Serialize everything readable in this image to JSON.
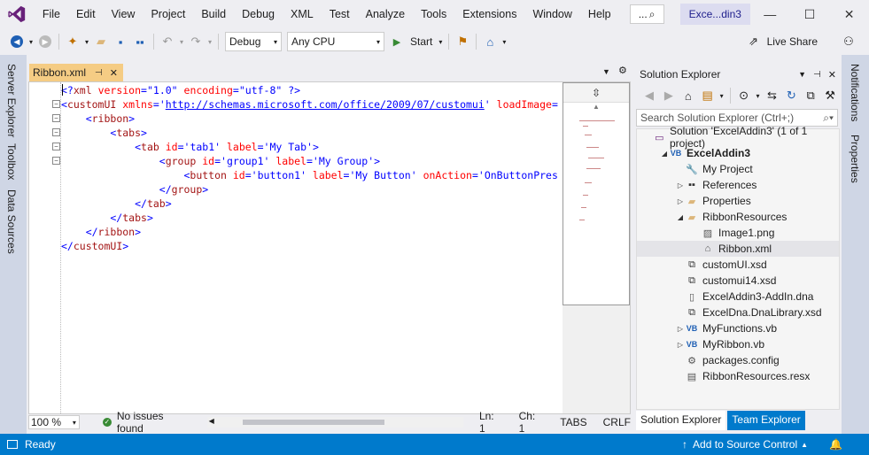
{
  "menu": [
    "File",
    "Edit",
    "View",
    "Project",
    "Build",
    "Debug",
    "XML",
    "Test",
    "Analyze",
    "Tools",
    "Extensions",
    "Window",
    "Help"
  ],
  "search_box": "...",
  "window_title": "Exce...din3",
  "toolbar": {
    "config": "Debug",
    "platform": "Any CPU",
    "start_label": "Start",
    "live_share_label": "Live Share"
  },
  "left_dock": [
    "Server Explorer",
    "Toolbox",
    "Data Sources"
  ],
  "right_dock": [
    "Notifications",
    "Properties"
  ],
  "editor": {
    "tab_label": "Ribbon.xml",
    "lines": [
      [
        [
          "x-punct",
          "<?"
        ],
        [
          "x-tag",
          "xml"
        ],
        [
          "x-attr",
          " version"
        ],
        [
          "x-punct",
          "="
        ],
        [
          "x-val",
          "\"1.0\""
        ],
        [
          "x-attr",
          " encoding"
        ],
        [
          "x-punct",
          "="
        ],
        [
          "x-val",
          "\"utf-8\""
        ],
        [
          "x-punct",
          " ?>"
        ]
      ],
      [
        [
          "x-punct",
          "<"
        ],
        [
          "x-tag",
          "customUI"
        ],
        [
          "x-attr",
          " xmlns"
        ],
        [
          "x-punct",
          "="
        ],
        [
          "x-punct",
          "'"
        ],
        [
          "x-url",
          "http://schemas.microsoft.com/office/2009/07/customui"
        ],
        [
          "x-punct",
          "'"
        ],
        [
          "x-attr",
          " loadImage"
        ],
        [
          "x-punct",
          "="
        ]
      ],
      [
        [
          "x-punct",
          "    <"
        ],
        [
          "x-tag",
          "ribbon"
        ],
        [
          "x-punct",
          ">"
        ]
      ],
      [
        [
          "x-punct",
          "        <"
        ],
        [
          "x-tag",
          "tabs"
        ],
        [
          "x-punct",
          ">"
        ]
      ],
      [
        [
          "x-punct",
          "            <"
        ],
        [
          "x-tag",
          "tab"
        ],
        [
          "x-attr",
          " id"
        ],
        [
          "x-punct",
          "="
        ],
        [
          "x-val",
          "'tab1'"
        ],
        [
          "x-attr",
          " label"
        ],
        [
          "x-punct",
          "="
        ],
        [
          "x-val",
          "'My Tab'"
        ],
        [
          "x-punct",
          ">"
        ]
      ],
      [
        [
          "x-punct",
          "                <"
        ],
        [
          "x-tag",
          "group"
        ],
        [
          "x-attr",
          " id"
        ],
        [
          "x-punct",
          "="
        ],
        [
          "x-val",
          "'group1'"
        ],
        [
          "x-attr",
          " label"
        ],
        [
          "x-punct",
          "="
        ],
        [
          "x-val",
          "'My Group'"
        ],
        [
          "x-punct",
          ">"
        ]
      ],
      [
        [
          "x-punct",
          "                    <"
        ],
        [
          "x-tag",
          "button"
        ],
        [
          "x-attr",
          " id"
        ],
        [
          "x-punct",
          "="
        ],
        [
          "x-val",
          "'button1'"
        ],
        [
          "x-attr",
          " label"
        ],
        [
          "x-punct",
          "="
        ],
        [
          "x-val",
          "'My Button'"
        ],
        [
          "x-attr",
          " onAction"
        ],
        [
          "x-punct",
          "="
        ],
        [
          "x-val",
          "'OnButtonPres"
        ]
      ],
      [
        [
          "x-punct",
          "                </"
        ],
        [
          "x-tag",
          "group"
        ],
        [
          "x-punct",
          ">"
        ]
      ],
      [
        [
          "x-punct",
          "            </"
        ],
        [
          "x-tag",
          "tab"
        ],
        [
          "x-punct",
          ">"
        ]
      ],
      [
        [
          "x-punct",
          "        </"
        ],
        [
          "x-tag",
          "tabs"
        ],
        [
          "x-punct",
          ">"
        ]
      ],
      [
        [
          "x-punct",
          "    </"
        ],
        [
          "x-tag",
          "ribbon"
        ],
        [
          "x-punct",
          ">"
        ]
      ],
      [
        [
          "x-punct",
          "</"
        ],
        [
          "x-tag",
          "customUI"
        ],
        [
          "x-punct",
          ">"
        ]
      ]
    ],
    "zoom": "100 %",
    "issues": "No issues found",
    "ln": "Ln: 1",
    "ch": "Ch: 1",
    "tabs": "TABS",
    "crlf": "CRLF"
  },
  "solution_explorer": {
    "title": "Solution Explorer",
    "search_placeholder": "Search Solution Explorer (Ctrl+;)",
    "items": [
      {
        "label": "Solution 'ExcelAddin3' (1 of 1 project)",
        "icon": "solution-icon",
        "arrow": "",
        "indent": 0,
        "bold": false
      },
      {
        "label": "ExcelAddin3",
        "icon": "vb-project-icon",
        "arrow": "expanded",
        "indent": 1,
        "bold": true
      },
      {
        "label": "My Project",
        "icon": "wrench-icon",
        "arrow": "",
        "indent": 2,
        "bold": false
      },
      {
        "label": "References",
        "icon": "references-icon",
        "arrow": "collapsed",
        "indent": 2,
        "bold": false
      },
      {
        "label": "Properties",
        "icon": "folder-icon",
        "arrow": "collapsed",
        "indent": 2,
        "bold": false
      },
      {
        "label": "RibbonResources",
        "icon": "folder-open-icon",
        "arrow": "expanded",
        "indent": 2,
        "bold": false
      },
      {
        "label": "Image1.png",
        "icon": "image-icon",
        "arrow": "",
        "indent": 3,
        "bold": false
      },
      {
        "label": "Ribbon.xml",
        "icon": "xml-file-icon",
        "arrow": "",
        "indent": 3,
        "bold": false
      },
      {
        "label": "customUI.xsd",
        "icon": "xsd-icon",
        "arrow": "",
        "indent": 2,
        "bold": false
      },
      {
        "label": "customui14.xsd",
        "icon": "xsd-icon",
        "arrow": "",
        "indent": 2,
        "bold": false
      },
      {
        "label": "ExcelAddin3-AddIn.dna",
        "icon": "file-icon",
        "arrow": "",
        "indent": 2,
        "bold": false
      },
      {
        "label": "ExcelDna.DnaLibrary.xsd",
        "icon": "xsd-icon",
        "arrow": "",
        "indent": 2,
        "bold": false
      },
      {
        "label": "MyFunctions.vb",
        "icon": "vb-file-icon",
        "arrow": "collapsed",
        "indent": 2,
        "bold": false
      },
      {
        "label": "MyRibbon.vb",
        "icon": "vb-file-icon",
        "arrow": "collapsed",
        "indent": 2,
        "bold": false
      },
      {
        "label": "packages.config",
        "icon": "config-icon",
        "arrow": "",
        "indent": 2,
        "bold": false
      },
      {
        "label": "RibbonResources.resx",
        "icon": "resx-icon",
        "arrow": "",
        "indent": 2,
        "bold": false
      }
    ],
    "selected_item": "Ribbon.xml",
    "bottom_tabs": [
      "Solution Explorer",
      "Team Explorer"
    ]
  },
  "statusbar": {
    "ready": "Ready",
    "source_control": "Add to Source Control"
  },
  "colors": {
    "accent": "#007acc",
    "editor_tab": "#f5cc84",
    "dock": "#cfd6e5",
    "vs_purple": "#68217a"
  }
}
